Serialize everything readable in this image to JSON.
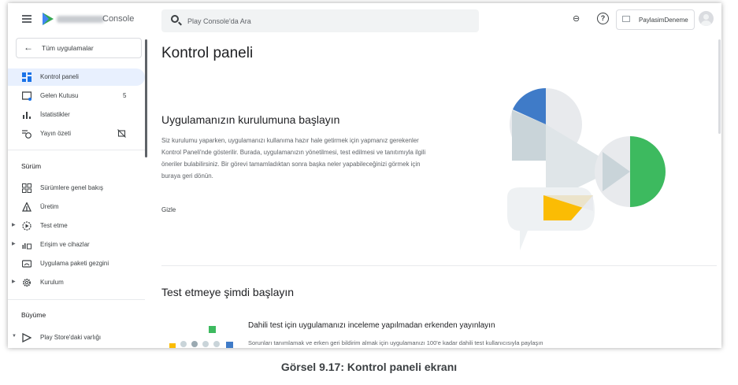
{
  "app": {
    "brand_suffix": "Console"
  },
  "search": {
    "placeholder": "Play Console'da Ara"
  },
  "account": {
    "name": "PaylasimDeneme"
  },
  "sidebar": {
    "back_label": "Tüm uygulamalar",
    "items": [
      {
        "label": "Kontrol paneli",
        "icon": "dashboard-icon"
      },
      {
        "label": "Gelen Kutusu",
        "badge": "5",
        "icon": "inbox-icon"
      },
      {
        "label": "İstatistikler",
        "icon": "bar-chart-icon"
      },
      {
        "label": "Yayın özeti",
        "icon": "publishing-overview-icon"
      }
    ],
    "section_release": "Sürüm",
    "release_items": [
      {
        "label": "Sürümlere genel bakış",
        "icon": "release-overview-icon"
      },
      {
        "label": "Üretim",
        "icon": "production-icon"
      },
      {
        "label": "Test etme",
        "icon": "testing-icon"
      },
      {
        "label": "Erişim ve cihazlar",
        "icon": "reach-devices-icon"
      },
      {
        "label": "Uygulama paketi gezgini",
        "icon": "bundle-explorer-icon"
      },
      {
        "label": "Kurulum",
        "icon": "setup-gear-icon"
      }
    ],
    "section_growth": "Büyüme",
    "growth_items": [
      {
        "label": "Play Store'daki varlığı",
        "icon": "store-presence-icon"
      }
    ]
  },
  "main": {
    "title": "Kontrol paneli",
    "setup_heading": "Uygulamanızın kurulumuna başlayın",
    "setup_text": "Siz kurulumu yaparken, uygulamanızı kullanıma hazır hale getirmek için yapmanız gerekenler Kontrol Paneli'nde gösterilir. Burada, uygulamanızın yönetilmesi, test edilmesi ve tanıtımıyla ilgili öneriler bulabilirsiniz. Bir görevi tamamladıktan sonra başka neler yapabileceğinizi görmek için buraya geri dönün.",
    "hide_label": "Gizle",
    "test_heading": "Test etmeye şimdi başlayın",
    "test_card_title": "Dahili test için uygulamanızı inceleme yapılmadan erkenden yayınlayın",
    "test_card_text": "Sorunları tanımlamak ve erken geri bildirim almak için uygulamanızı 100'e kadar dahili test kullanıcısıyla paylaşın"
  },
  "caption": "Görsel 9.17: Kontrol paneli ekranı",
  "colors": {
    "accent_blue": "#3f7bc8",
    "green": "#3dba5f",
    "yellow": "#fbbc04",
    "active_nav": "#e8f0fe"
  }
}
